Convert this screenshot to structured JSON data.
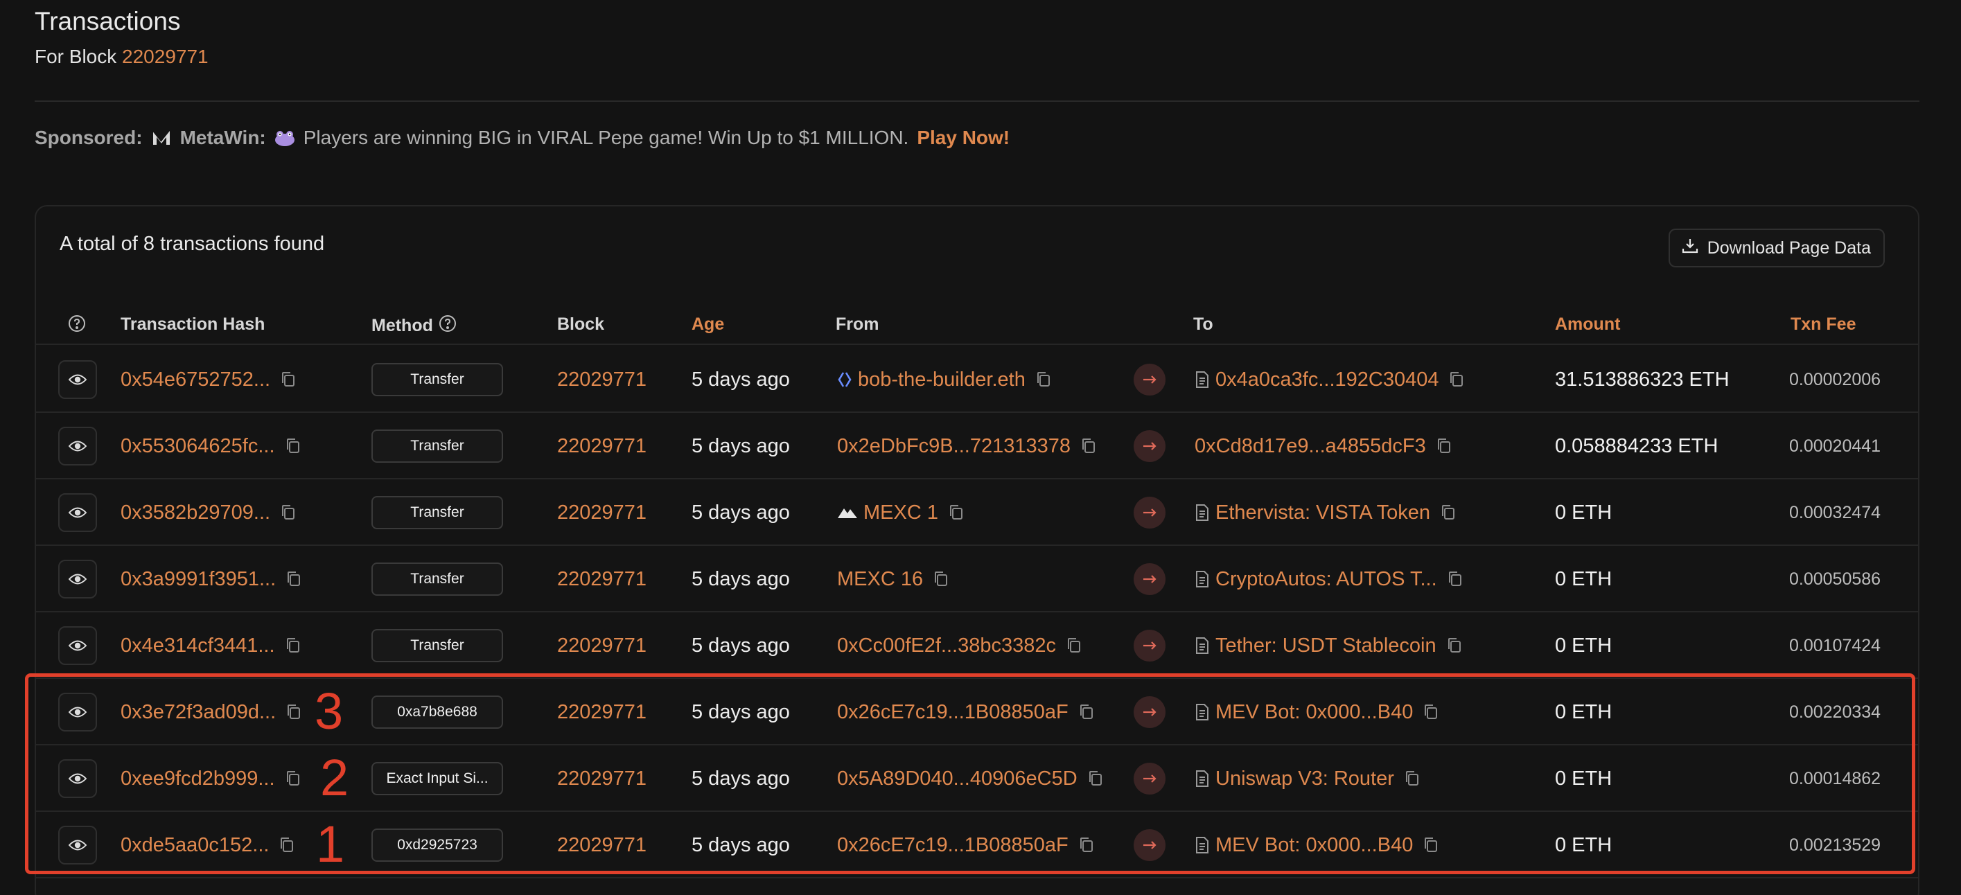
{
  "header": {
    "title": "Transactions",
    "subtitle_prefix": "For Block",
    "block_number": "22029771"
  },
  "sponsor": {
    "label": "Sponsored:",
    "brand": "MetaWin:",
    "message": "Players are winning BIG in VIRAL Pepe game! Win Up to $1 MILLION.",
    "cta": "Play Now!"
  },
  "table": {
    "summary": "A total of 8 transactions found",
    "download_label": "Download Page Data",
    "columns": {
      "hash": "Transaction Hash",
      "method": "Method",
      "block": "Block",
      "age": "Age",
      "from": "From",
      "to": "To",
      "amount": "Amount",
      "fee": "Txn Fee"
    },
    "rows": [
      {
        "hash": "0x54e6752752...",
        "method": "Transfer",
        "block": "22029771",
        "age": "5 days ago",
        "from": "bob-the-builder.eth",
        "from_icon": "ens-icon",
        "to": "0x4a0ca3fc...192C30404",
        "to_contract": true,
        "amount": "31.513886323 ETH",
        "fee": "0.00002006"
      },
      {
        "hash": "0x553064625fc...",
        "method": "Transfer",
        "block": "22029771",
        "age": "5 days ago",
        "from": "0x2eDbFc9B...721313378",
        "from_icon": "",
        "to": "0xCd8d17e9...a4855dcF3",
        "to_contract": false,
        "amount": "0.058884233 ETH",
        "fee": "0.00020441"
      },
      {
        "hash": "0x3582b29709...",
        "method": "Transfer",
        "block": "22029771",
        "age": "5 days ago",
        "from": "MEXC 1",
        "from_icon": "mexc-icon",
        "to": "Ethervista: VISTA Token",
        "to_contract": true,
        "amount": "0 ETH",
        "fee": "0.00032474"
      },
      {
        "hash": "0x3a9991f3951...",
        "method": "Transfer",
        "block": "22029771",
        "age": "5 days ago",
        "from": "MEXC 16",
        "from_icon": "",
        "to": "CryptoAutos: AUTOS T...",
        "to_contract": true,
        "amount": "0 ETH",
        "fee": "0.00050586"
      },
      {
        "hash": "0x4e314cf3441...",
        "method": "Transfer",
        "block": "22029771",
        "age": "5 days ago",
        "from": "0xCc00fE2f...38bc3382c",
        "from_icon": "",
        "to": "Tether: USDT Stablecoin",
        "to_contract": true,
        "amount": "0 ETH",
        "fee": "0.00107424"
      },
      {
        "hash": "0x3e72f3ad09d...",
        "method": "0xa7b8e688",
        "block": "22029771",
        "age": "5 days ago",
        "from": "0x26cE7c19...1B08850aF",
        "from_icon": "",
        "to": "MEV Bot: 0x000...B40",
        "to_contract": true,
        "amount": "0 ETH",
        "fee": "0.00220334"
      },
      {
        "hash": "0xee9fcd2b999...",
        "method": "Exact Input Si...",
        "block": "22029771",
        "age": "5 days ago",
        "from": "0x5A89D040...40906eC5D",
        "from_icon": "",
        "to": "Uniswap V3: Router",
        "to_contract": true,
        "amount": "0 ETH",
        "fee": "0.00014862"
      },
      {
        "hash": "0xde5aa0c152...",
        "method": "0xd2925723",
        "block": "22029771",
        "age": "5 days ago",
        "from": "0x26cE7c19...1B08850aF",
        "from_icon": "",
        "to": "MEV Bot: 0x000...B40",
        "to_contract": true,
        "amount": "0 ETH",
        "fee": "0.00213529"
      }
    ]
  },
  "annotations": [
    "3",
    "2",
    "1"
  ],
  "colors": {
    "accent": "#e0894f",
    "highlight": "#e2402b",
    "background": "#131313"
  }
}
